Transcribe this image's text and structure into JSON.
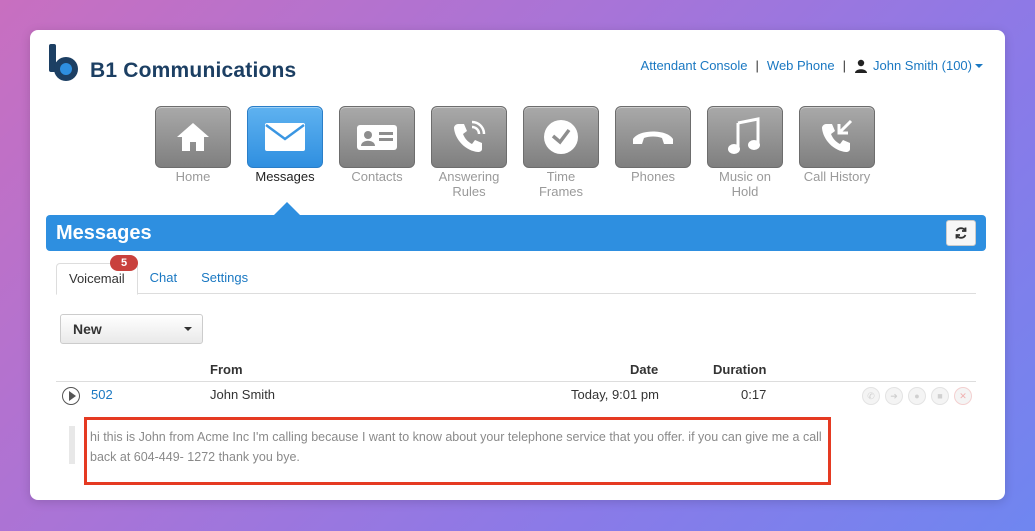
{
  "app": {
    "name": "B1 Communications",
    "logo_letter": "b"
  },
  "header": {
    "links": [
      {
        "label": "Attendant Console"
      },
      {
        "label": "Web Phone"
      }
    ],
    "user": "John Smith (100)"
  },
  "nav": [
    {
      "label": "Home",
      "icon": "home-icon",
      "active": false
    },
    {
      "label": "Messages",
      "icon": "envelope-icon",
      "active": true
    },
    {
      "label": "Contacts",
      "icon": "contact-card-icon",
      "active": false
    },
    {
      "label": "Answering Rules",
      "icon": "phone-ringing-icon",
      "active": false
    },
    {
      "label": "Time Frames",
      "icon": "clock-icon",
      "active": false
    },
    {
      "label": "Phones",
      "icon": "handset-icon",
      "active": false
    },
    {
      "label": "Music on Hold",
      "icon": "music-note-icon",
      "active": false
    },
    {
      "label": "Call History",
      "icon": "call-history-icon",
      "active": false
    }
  ],
  "page": {
    "title": "Messages"
  },
  "tabs": [
    {
      "label": "Voicemail",
      "badge": "5",
      "active": true
    },
    {
      "label": "Chat",
      "active": false
    },
    {
      "label": "Settings",
      "active": false
    }
  ],
  "filter": {
    "selected": "New"
  },
  "table": {
    "headers": {
      "from": "From",
      "date": "Date",
      "duration": "Duration"
    },
    "rows": [
      {
        "extension": "502",
        "name": "John Smith",
        "date": "Today, 9:01 pm",
        "duration": "0:17",
        "transcript": "hi this is John from Acme Inc I'm calling because I want to know about your telephone service that you offer. if you can give me a call back at 604-449- 1272 thank you bye."
      }
    ]
  },
  "colors": {
    "brand": "#1c3f63",
    "accent": "#2e8fe0",
    "link": "#1a78c2",
    "badge": "#c9413d",
    "highlight": "#e53a22"
  }
}
